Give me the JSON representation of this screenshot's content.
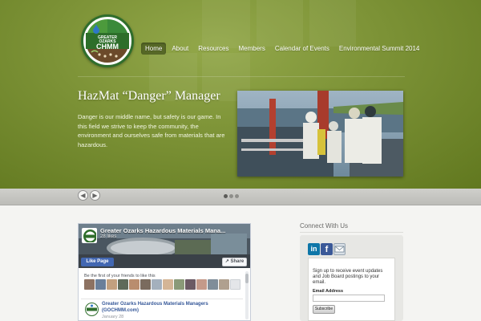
{
  "logo": {
    "line1": "GREATER",
    "line2": "OZARKS",
    "line3": "CHMM"
  },
  "nav": {
    "items": [
      {
        "label": "Home",
        "active": true
      },
      {
        "label": "About"
      },
      {
        "label": "Resources"
      },
      {
        "label": "Members"
      },
      {
        "label": "Calendar of Events"
      },
      {
        "label": "Environmental Summit 2014"
      }
    ]
  },
  "slider": {
    "title": "HazMat “Danger” Manager",
    "text": "Danger is our middle name, but safety is our game. In this field we strive to keep the community, the environment and ourselves safe from materials that are hazardous.",
    "prev_icon": "arrow-left-icon",
    "next_icon": "arrow-right-icon",
    "dots": 3,
    "active_dot": 1
  },
  "facebook": {
    "page_name": "Greater Ozarks Hazardous Materials Mana...",
    "likes": "28 likes",
    "like_button": "Like Page",
    "share_button": "Share",
    "friends_text": "Be the first of your friends to like this",
    "post_name": "Greater Ozarks Hazardous Materials Managers (GOCHMM.com)",
    "post_date": "January 28"
  },
  "sidebar": {
    "title": "Connect With Us",
    "social": [
      {
        "icon": "linkedin-icon",
        "label": "in",
        "color": "#0e76a8"
      },
      {
        "icon": "facebook-icon",
        "label": "f",
        "color": "#3b5998"
      },
      {
        "icon": "email-icon",
        "label": "",
        "color": "#d8dfe6"
      }
    ],
    "signup_text": "Sign up to receive event updates and Job Board postings to your email.",
    "email_label": "Email Address",
    "email_value": "",
    "subscribe_label": "Subscribe"
  },
  "colors": {
    "hero_green": "#7c9236",
    "logo_green": "#2f6e2c",
    "fb_blue": "#4267b2"
  }
}
